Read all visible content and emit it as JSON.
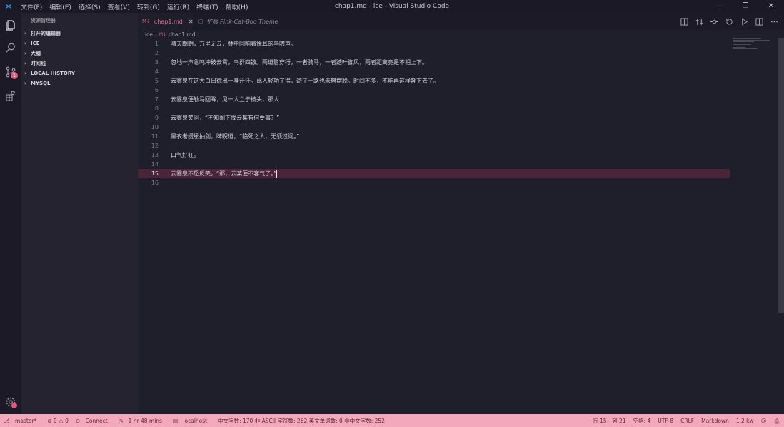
{
  "titlebar": {
    "menu": [
      "文件(F)",
      "编辑(E)",
      "选择(S)",
      "查看(V)",
      "转到(G)",
      "运行(R)",
      "终端(T)",
      "帮助(H)"
    ],
    "window_title": "chap1.md - ice - Visual Studio Code"
  },
  "sidebar": {
    "title": "资源管理器",
    "sections": [
      "打开的编辑器",
      "ICE",
      "大纲",
      "时间线",
      "LOCAL HISTORY",
      "MYSQL"
    ]
  },
  "activity": {
    "badge_count": "1"
  },
  "tabs": [
    {
      "label": "chap1.md",
      "active": true
    },
    {
      "label": "扩展 Pink-Cat-Boo Theme",
      "active": false
    }
  ],
  "breadcrumb": [
    "ice",
    "chap1.md"
  ],
  "editor": {
    "lines": [
      "晴天朗朗，万里无云，林中回响着悦耳的鸟啼声。",
      "",
      "忽地一声急鸣冲破云霄，鸟群四散。两道影穿行，一者骑马，一者踏叶御风，两者距离竟是不相上下。",
      "",
      "云霎泉在这大白日徐出一身汗汗。此人轻功了得，避了一路也未曾摆脱。时间不多，不能再这样耗下去了。",
      "",
      "云霎泉便勒马回眸，见一人立于枝头，那人",
      "",
      "云霎泉笑问，“不知阁下找云某有何要事？”",
      "",
      "黑衣者缓缓抽剑，睥睨道，“临死之人，无须过问。”",
      "",
      "口气好狂。",
      "",
      "云霎泉不怒反笑，“那，云某便不客气了。”",
      ""
    ],
    "current_line": 15
  },
  "statusbar": {
    "left": [
      "master*",
      "⊗ 0 ⚠ 0",
      "Connect",
      "1 hr 48 mins",
      "localhost",
      "中文字数: 170 非 ASCII 字符数: 262 英文单词数: 0 非中文字数: 252"
    ],
    "right": [
      "行 15，列 21",
      "空格: 4",
      "UTF-8",
      "CRLF",
      "Markdown",
      "1.2 kw"
    ]
  },
  "colors": {
    "accent": "#e86d93",
    "statusbar": "#f3a9bb",
    "current_line": "#4a2438",
    "background": "#1f1e2b"
  }
}
